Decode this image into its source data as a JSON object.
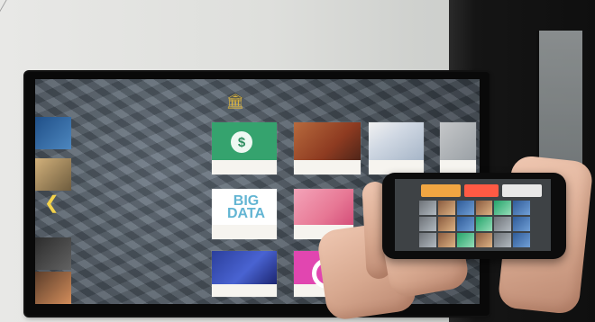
{
  "phone": {
    "tabs": [
      "",
      "",
      ""
    ],
    "brand": ""
  },
  "tv": {
    "status": ""
  },
  "left_column": {
    "items": [
      "",
      "",
      "",
      ""
    ]
  },
  "tiles": [
    {
      "label": ""
    },
    {
      "label": ""
    },
    {
      "label": ""
    },
    {
      "label": ""
    },
    {
      "label": ""
    },
    {
      "label": ""
    },
    {
      "label": ""
    },
    {
      "label": ""
    }
  ],
  "big_tile": {
    "big": "BIG",
    "data": "DATA"
  }
}
